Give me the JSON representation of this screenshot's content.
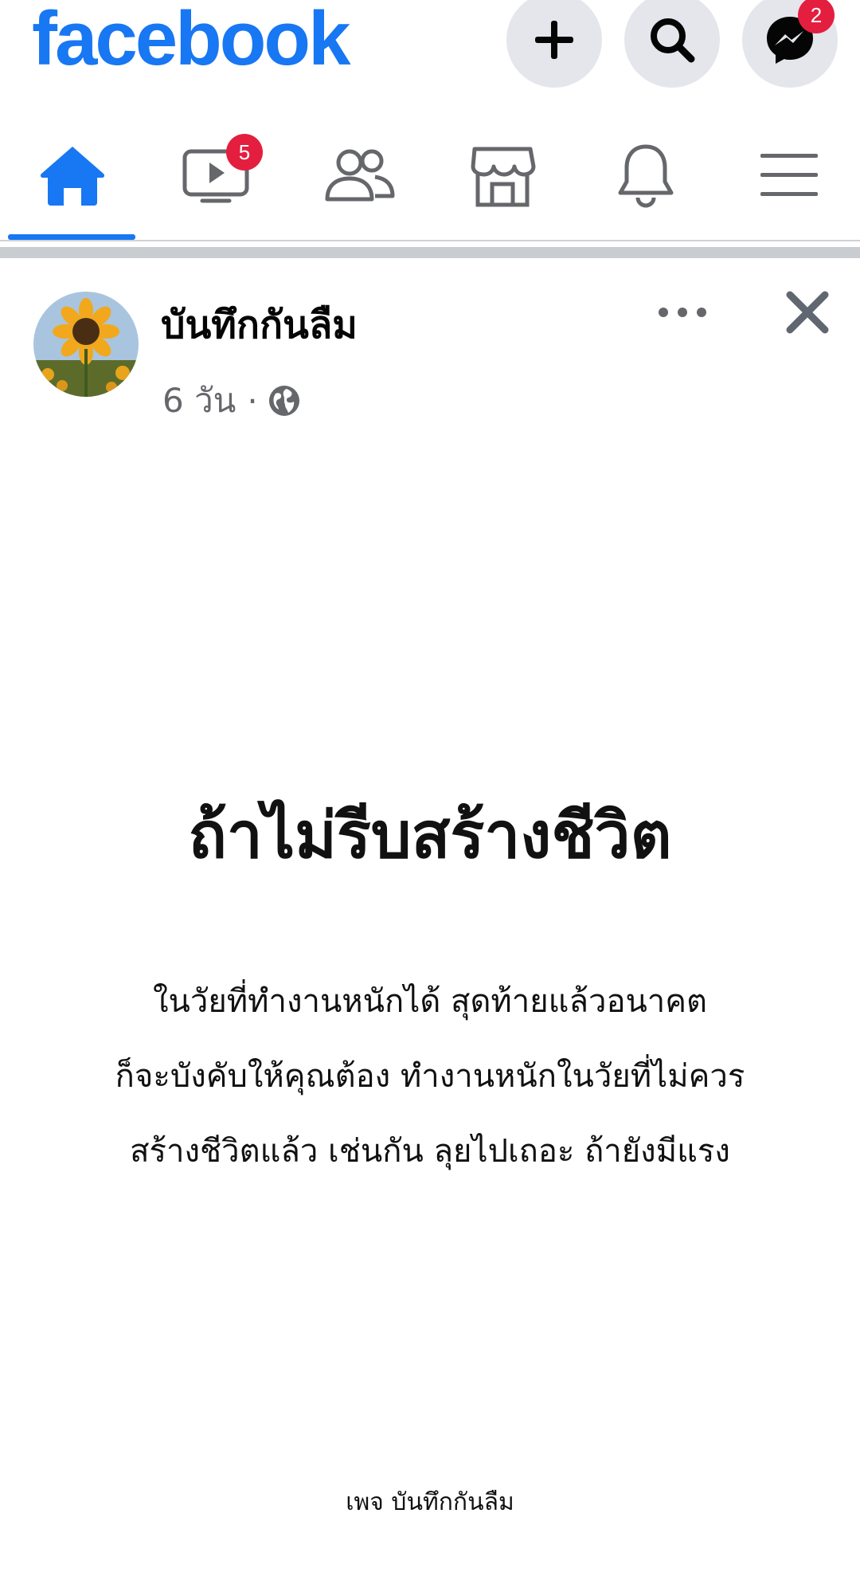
{
  "header": {
    "logo_text": "facebook",
    "brand_color": "#1877f2",
    "actions": [
      {
        "name": "create",
        "icon": "plus-icon"
      },
      {
        "name": "search",
        "icon": "search-icon"
      },
      {
        "name": "messenger",
        "icon": "messenger-icon",
        "badge": "2"
      }
    ]
  },
  "tabs": [
    {
      "name": "home",
      "icon": "home-icon",
      "active": true
    },
    {
      "name": "watch",
      "icon": "video-icon",
      "badge": "5"
    },
    {
      "name": "friends",
      "icon": "friends-icon"
    },
    {
      "name": "marketplace",
      "icon": "marketplace-icon"
    },
    {
      "name": "notifications",
      "icon": "bell-icon"
    },
    {
      "name": "menu",
      "icon": "hamburger-menu-icon"
    }
  ],
  "post": {
    "author": "บันทึกกันลืม",
    "time": "6 วัน",
    "separator": "·",
    "privacy_icon": "globe-icon",
    "title": "ถ้าไม่รีบสร้างชีวิต",
    "body_lines": [
      "ในวัยที่ทำงานหนักได้ สุดท้ายแล้วอนาคต",
      "ก็จะบังคับให้คุณต้อง ทำงานหนักในวัยที่ไม่ควร",
      "สร้างชีวิตแล้ว เช่นกัน ลุยไปเถอะ ถ้ายังมีแรง"
    ],
    "footer": "เพจ บันทึกกันลืม"
  }
}
